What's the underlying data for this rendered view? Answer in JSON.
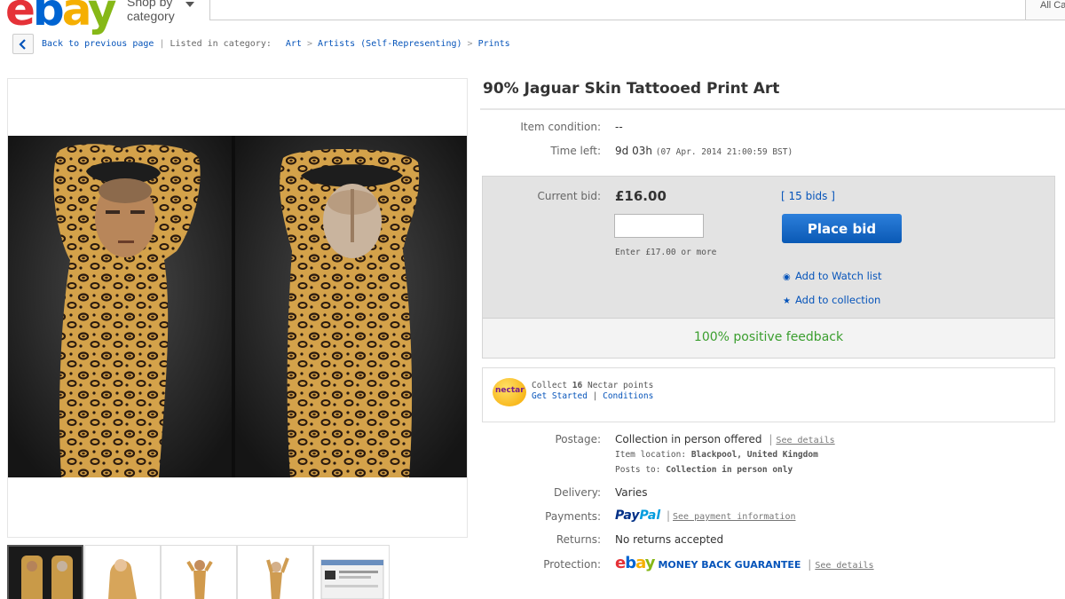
{
  "header": {
    "logo": [
      "e",
      "b",
      "a",
      "y"
    ],
    "shop_by_1": "Shop by",
    "shop_by_2": "category",
    "search_category": "All Categories"
  },
  "breadcrumb": {
    "back": "Back to previous page",
    "listed": "Listed in category:",
    "items": [
      "Art",
      "Artists (Self-Representing)",
      "Prints"
    ]
  },
  "listing": {
    "title": "90% Jaguar Skin Tattooed Print Art",
    "item_condition_label": "Item condition:",
    "item_condition_value": "--",
    "time_left_label": "Time left:",
    "time_left_value": "9d 03h",
    "time_left_date": "(07 Apr. 2014  21:00:59 BST)"
  },
  "bid": {
    "current_bid_label": "Current bid:",
    "current_bid_value": "£16.00",
    "bids_link": "[ 15 bids ]",
    "input_value": "",
    "enter_note": "Enter £17.00 or more",
    "place_bid": "Place bid",
    "watch_list": "Add to Watch list",
    "collection": "Add to collection",
    "feedback": "100% positive feedback"
  },
  "nectar": {
    "logo_text": "nectar",
    "collect_pre": "Collect",
    "points": "16",
    "collect_post": "Nectar points",
    "get_started": "Get Started",
    "conditions": "Conditions"
  },
  "details": {
    "postage_label": "Postage:",
    "postage_value": "Collection in person offered",
    "postage_link": "See details",
    "location_label": "Item location:",
    "location_value": "Blackpool, United Kingdom",
    "posts_label": "Posts to:",
    "posts_value": "Collection in person only",
    "delivery_label": "Delivery:",
    "delivery_value": "Varies",
    "payments_label": "Payments:",
    "paypal_1": "Pay",
    "paypal_2": "Pal",
    "payments_link": "See payment information",
    "returns_label": "Returns:",
    "returns_value": "No returns accepted",
    "protection_label": "Protection:",
    "mbg_text": "MONEY BACK GUARANTEE",
    "protection_link": "See details"
  },
  "colors": {
    "ebay_red": "#e53238",
    "ebay_blue": "#0064d2",
    "ebay_yellow": "#f5af02",
    "ebay_green": "#86b817",
    "link": "#0654ba",
    "feedback_green": "#3a9e2e"
  }
}
